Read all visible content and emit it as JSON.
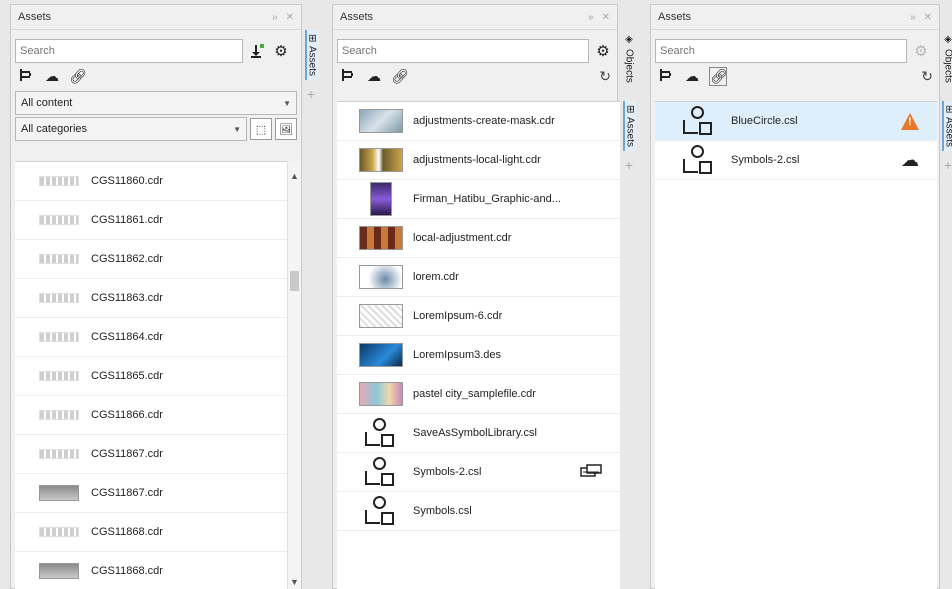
{
  "panel1": {
    "title": "Assets",
    "search_placeholder": "Search",
    "content_filter": "All content",
    "category_filter": "All categories",
    "side_tab": "Assets",
    "items": [
      {
        "name": "CGS11860.cdr",
        "thumb": "gray"
      },
      {
        "name": "CGS11861.cdr",
        "thumb": "gray"
      },
      {
        "name": "CGS11862.cdr",
        "thumb": "gray"
      },
      {
        "name": "CGS11863.cdr",
        "thumb": "gray"
      },
      {
        "name": "CGS11864.cdr",
        "thumb": "gray"
      },
      {
        "name": "CGS11865.cdr",
        "thumb": "gray"
      },
      {
        "name": "CGS11866.cdr",
        "thumb": "gray"
      },
      {
        "name": "CGS11867.cdr",
        "thumb": "gray"
      },
      {
        "name": "CGS11867.cdr",
        "thumb": "dark"
      },
      {
        "name": "CGS11868.cdr",
        "thumb": "gray"
      },
      {
        "name": "CGS11868.cdr",
        "thumb": "dark"
      }
    ]
  },
  "panel2": {
    "title": "Assets",
    "search_placeholder": "Search",
    "side_tab_objects": "Objects",
    "side_tab_assets": "Assets",
    "items": [
      {
        "name": "adjustments-create-mask.cdr",
        "thumb": "img1"
      },
      {
        "name": "adjustments-local-light.cdr",
        "thumb": "img2"
      },
      {
        "name": "Firman_Hatibu_Graphic-and...",
        "thumb": "img3"
      },
      {
        "name": "local-adjustment.cdr",
        "thumb": "img4"
      },
      {
        "name": "lorem.cdr",
        "thumb": "img5"
      },
      {
        "name": "LoremIpsum-6.cdr",
        "thumb": "img6"
      },
      {
        "name": "LoremIpsum3.des",
        "thumb": "img7"
      },
      {
        "name": "pastel city_samplefile.cdr",
        "thumb": "img8"
      },
      {
        "name": "SaveAsSymbolLibrary.csl",
        "thumb": "sym"
      },
      {
        "name": "Symbols-2.csl",
        "thumb": "sym",
        "status": "linked-icon"
      },
      {
        "name": "Symbols.csl",
        "thumb": "sym"
      }
    ]
  },
  "panel3": {
    "title": "Assets",
    "search_placeholder": "Search",
    "side_tab_objects": "Objects",
    "side_tab_assets": "Assets",
    "items": [
      {
        "name": "BlueCircle.csl",
        "status": "warning-icon",
        "selected": true
      },
      {
        "name": "Symbols-2.csl",
        "status": "cloud-icon",
        "selected": false
      }
    ]
  },
  "colors": {
    "accent": "#6aa6da",
    "selection": "#dfeefb",
    "warning": "#e8762d"
  }
}
